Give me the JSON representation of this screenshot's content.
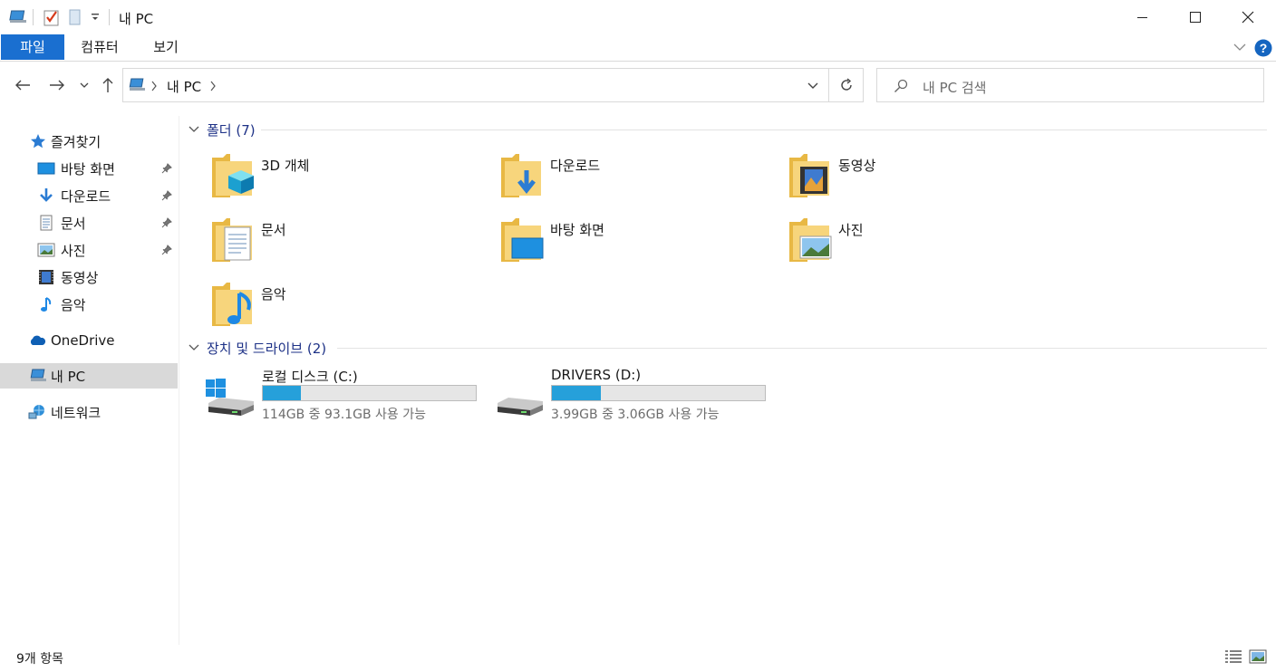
{
  "window": {
    "title": "내 PC",
    "quick_access_icons": [
      "computer-icon",
      "properties-checkmark-icon",
      "new-folder-icon",
      "customize-dropdown-icon"
    ],
    "controls": [
      "minimize",
      "maximize",
      "close"
    ]
  },
  "ribbon": {
    "tabs": [
      {
        "label": "파일",
        "active": true
      },
      {
        "label": "컴퓨터"
      },
      {
        "label": "보기"
      }
    ],
    "accent": "#1a6fd0"
  },
  "address": {
    "path": [
      "내 PC"
    ],
    "search_placeholder": "내 PC 검색"
  },
  "nav": {
    "quick_access_label": "즐겨찾기",
    "quick_items": [
      {
        "label": "바탕 화면",
        "icon": "desktop-icon",
        "pinned": true
      },
      {
        "label": "다운로드",
        "icon": "download-icon",
        "pinned": true
      },
      {
        "label": "문서",
        "icon": "document-icon",
        "pinned": true
      },
      {
        "label": "사진",
        "icon": "picture-icon",
        "pinned": true
      },
      {
        "label": "동영상",
        "icon": "video-icon",
        "pinned": false
      },
      {
        "label": "음악",
        "icon": "music-icon",
        "pinned": false
      }
    ],
    "onedrive_label": "OneDrive",
    "thispc_label": "내 PC",
    "network_label": "네트워크"
  },
  "content": {
    "folders_header": "폴더 (7)",
    "folders": [
      {
        "label": "3D 개체",
        "icon": "3d-objects-folder-icon"
      },
      {
        "label": "다운로드",
        "icon": "downloads-folder-icon"
      },
      {
        "label": "동영상",
        "icon": "videos-folder-icon"
      },
      {
        "label": "문서",
        "icon": "documents-folder-icon"
      },
      {
        "label": "바탕 화면",
        "icon": "desktop-folder-icon"
      },
      {
        "label": "사진",
        "icon": "pictures-folder-icon"
      },
      {
        "label": "음악",
        "icon": "music-folder-icon"
      }
    ],
    "drives_header": "장치 및 드라이브 (2)",
    "drives": [
      {
        "label": "로컬 디스크 (C:)",
        "size_text": "114GB 중 93.1GB 사용 가능",
        "used_fraction": 0.18,
        "icon": "windows-drive-icon"
      },
      {
        "label": "DRIVERS (D:)",
        "size_text": "3.99GB 중 3.06GB 사용 가능",
        "used_fraction": 0.23,
        "icon": "drive-icon"
      }
    ],
    "usage_bar_color": "#26a0da"
  },
  "status": {
    "item_count": "9개 항목",
    "view_icons": [
      "details-view-icon",
      "large-icons-view-icon"
    ]
  }
}
